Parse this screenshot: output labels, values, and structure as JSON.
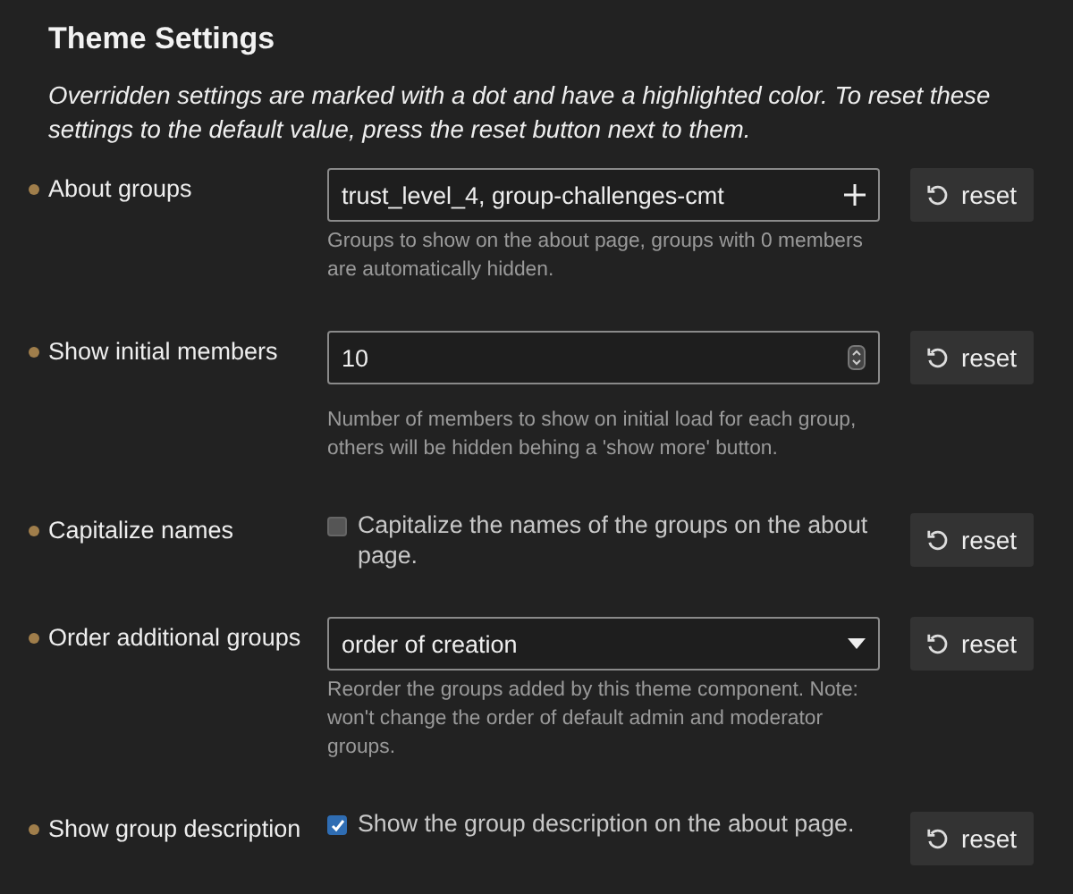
{
  "title": "Theme Settings",
  "intro": "Overridden settings are marked with a dot and have a highlighted color. To reset these settings to the default value, press the reset button next to them.",
  "settings": [
    {
      "label": "About groups",
      "overridden": true,
      "kind": "list",
      "value": "trust_level_4, group-challenges-cmt",
      "description": "Groups to show on the about page, groups with 0 members are automatically hidden.",
      "reset": "reset"
    },
    {
      "label": "Show initial members",
      "overridden": true,
      "kind": "number",
      "value": "10",
      "description": "Number of members to show on initial load for each group, others will be hidden behing a 'show more' button.",
      "reset": "reset"
    },
    {
      "label": "Capitalize names",
      "overridden": true,
      "kind": "checkbox",
      "checked": false,
      "description": "Capitalize the names of the groups on the about page.",
      "reset": "reset"
    },
    {
      "label": "Order additional groups",
      "overridden": true,
      "kind": "select",
      "value": "order of creation",
      "description": "Reorder the groups added by this theme component. Note: won't change the order of default admin and moderator groups.",
      "reset": "reset"
    },
    {
      "label": "Show group description",
      "overridden": true,
      "kind": "checkbox",
      "checked": true,
      "description": "Show the group description on the about page.",
      "reset": "reset"
    }
  ]
}
